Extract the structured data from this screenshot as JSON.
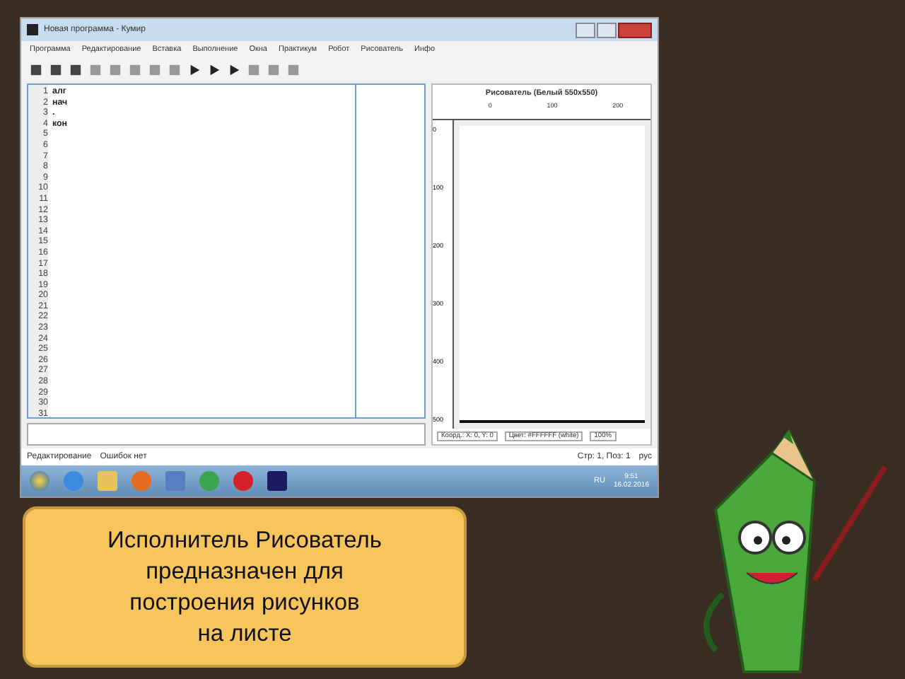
{
  "window": {
    "title": "Новая программа - Кумир"
  },
  "menu": [
    "Программа",
    "Редактирование",
    "Вставка",
    "Выполнение",
    "Окна",
    "Практикум",
    "Робот",
    "Рисователь",
    "Инфо"
  ],
  "editor": {
    "lines": [
      {
        "number": "1",
        "text": "алг"
      },
      {
        "number": "2",
        "text": "нач"
      },
      {
        "number": "3",
        "text": "."
      },
      {
        "number": "4",
        "text": "кон"
      },
      {
        "number": "5"
      },
      {
        "number": "6"
      },
      {
        "number": "7"
      },
      {
        "number": "8"
      },
      {
        "number": "9"
      },
      {
        "number": "10"
      },
      {
        "number": "11"
      },
      {
        "number": "12"
      },
      {
        "number": "13"
      },
      {
        "number": "14"
      },
      {
        "number": "15"
      },
      {
        "number": "16"
      },
      {
        "number": "17"
      },
      {
        "number": "18"
      },
      {
        "number": "19"
      },
      {
        "number": "20"
      },
      {
        "number": "21"
      },
      {
        "number": "22"
      },
      {
        "number": "23"
      },
      {
        "number": "24"
      },
      {
        "number": "25"
      },
      {
        "number": "26"
      },
      {
        "number": "27"
      },
      {
        "number": "28"
      },
      {
        "number": "29"
      },
      {
        "number": "30"
      },
      {
        "number": "31"
      }
    ]
  },
  "drawer": {
    "title": "Рисователь (Белый 550x550)",
    "top_ruler": [
      "0",
      "100",
      "200"
    ],
    "left_ruler": [
      "0",
      "100",
      "200",
      "300",
      "400",
      "500"
    ],
    "coords": "Коорд.: X: 0, Y: 0",
    "color_reading": "Цвет: #FFFFFF (white)",
    "zoom": "100%"
  },
  "status_bar": {
    "mode": "Редактирование",
    "errors": "Ошибок нет",
    "position": "Стр: 1, Поз: 1",
    "input": "рус"
  },
  "taskbar": {
    "language": "RU",
    "time": "9:51",
    "date": "16.02.2016"
  },
  "callout": {
    "text": "Исполнитель Рисователь\nпредназначен для\nпостроения рисунков\nна листе"
  }
}
